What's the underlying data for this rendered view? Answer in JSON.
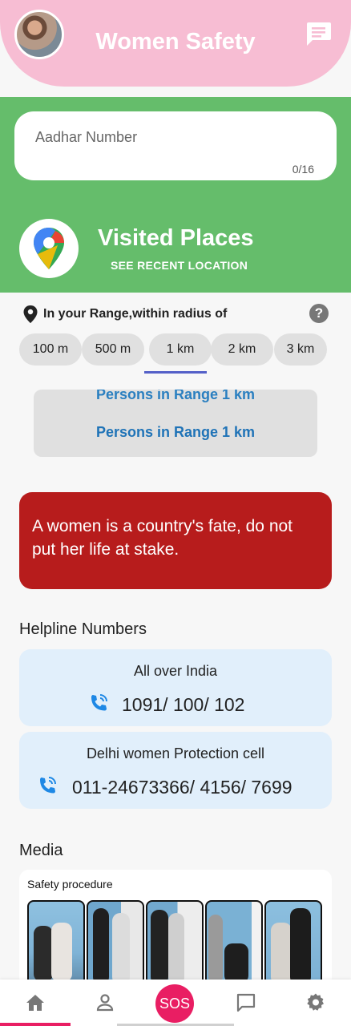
{
  "header": {
    "title": "Women Safety"
  },
  "aadhar": {
    "placeholder": "Aadhar Number",
    "counter": "0/16"
  },
  "visited": {
    "title": "Visited Places",
    "subtitle": "SEE RECENT LOCATION"
  },
  "range": {
    "label": "In your Range,within radius of",
    "help": "?",
    "options": [
      "100 m",
      "500 m",
      "1 km",
      "2 km",
      "3 km"
    ],
    "selected": "1 km"
  },
  "persons": {
    "ghost": "Persons in Range 1 km",
    "text": "Persons in Range 1 km"
  },
  "quote": {
    "text": "A women is a country's fate, do not put her life at stake."
  },
  "helpline": {
    "heading": "Helpline Numbers",
    "cards": [
      {
        "title": "All over India",
        "number": "1091/ 100/ 102"
      },
      {
        "title": "Delhi women Protection cell",
        "number": "011-24673366/ 4156/ 7699"
      }
    ]
  },
  "media": {
    "heading": "Media",
    "card_label": "Safety procedure"
  },
  "bottom_nav": {
    "sos": "SOS",
    "items": [
      "home-icon",
      "profile-icon",
      "sos-button",
      "chat-icon",
      "settings-icon"
    ]
  },
  "colors": {
    "header_pink": "#f7bdd3",
    "green": "#65bd6b",
    "quote_red": "#b71c1c",
    "card_blue": "#e1effb",
    "sos_pink": "#e91e63",
    "link_blue": "#1f73b7"
  }
}
